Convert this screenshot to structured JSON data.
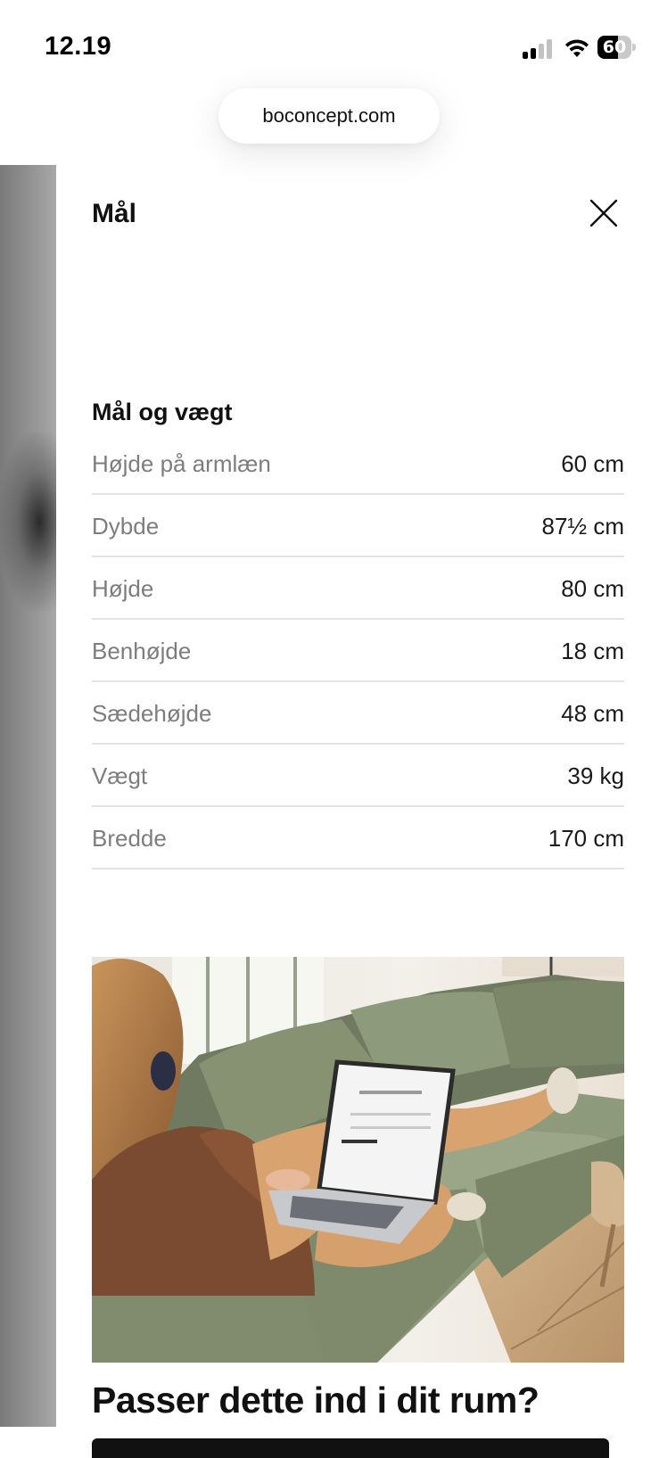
{
  "status_bar": {
    "time": "12.19",
    "battery_level": "60",
    "battery_fraction": 0.6,
    "signal_bars_active": 2,
    "signal_bars_total": 4
  },
  "browser": {
    "url": "boconcept.com"
  },
  "panel": {
    "title": "Mål",
    "close_icon": "close-icon"
  },
  "dimensions": {
    "title": "Mål og vægt",
    "rows": [
      {
        "label": "Højde på armlæn",
        "value": "60 cm"
      },
      {
        "label": "Dybde",
        "value": "87½ cm"
      },
      {
        "label": "Højde",
        "value": "80 cm"
      },
      {
        "label": "Benhøjde",
        "value": "18 cm"
      },
      {
        "label": "Sædehøjde",
        "value": "48 cm"
      },
      {
        "label": "Vægt",
        "value": "39 kg"
      },
      {
        "label": "Bredde",
        "value": "170 cm"
      }
    ]
  },
  "promo": {
    "heading": "Passer dette ind i dit rum?"
  },
  "colors": {
    "sofa_green": "#8e9a7c",
    "backdrop_grey": "#959595",
    "divider": "#e4e4e4",
    "label_grey": "#7d7d7d"
  }
}
